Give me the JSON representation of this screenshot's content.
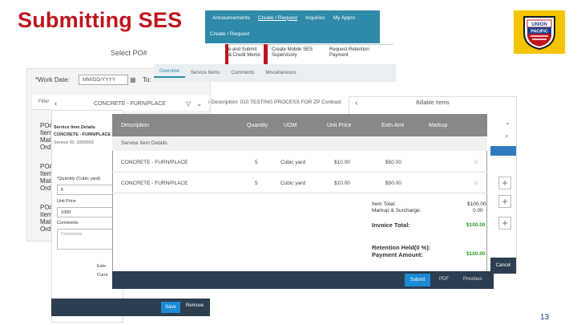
{
  "slide": {
    "title": "Submitting SES",
    "page_number": "13",
    "logo_text": [
      "UNION",
      "PACIFIC"
    ]
  },
  "topnav": {
    "items": [
      "Announcements",
      "Create / Request",
      "Inquiries",
      "My Appro"
    ],
    "sub_label": "Create / Request"
  },
  "dropdown": {
    "col1": [
      "e and Submit",
      "& Credit Memo"
    ],
    "col2": [
      "Create Mobile SES",
      "Supervisory"
    ],
    "col3": [
      "Request Retention",
      "Payment"
    ]
  },
  "select_po": "Select PO#",
  "work_date": {
    "label": "*Work Date:",
    "value": "MM/DD/YYYY",
    "to_label": "To:"
  },
  "filter": {
    "label": "Filter"
  },
  "po_items": [
    {
      "lines": [
        "PO#",
        "Item",
        "Mate",
        "Ord"
      ]
    },
    {
      "lines": [
        "PO#",
        "Item",
        "Mate",
        "Ord"
      ]
    },
    {
      "lines": [
        "PO#",
        "Item",
        "Mate",
        "Ord"
      ]
    }
  ],
  "overview_tabs": [
    "Overview",
    "Service Items",
    "Comments",
    "Miscellaneous"
  ],
  "description_line": "n Description: 010 TESTING PROCESS FOR ZP Contract",
  "service_panel": {
    "header": "CONCRETE - FURN/PLACE",
    "details_title": "Service Item Details",
    "item_name": "CONCRETE - FURN/PLACE",
    "service_id": "Service ID: 1000003",
    "quantity_label": "*Quantity (Cubic yard)",
    "quantity_value": "5",
    "unit_price_label": "Unit Price",
    "unit_price_value": "1000",
    "comments_label": "Comments",
    "comments_placeholder": "Comments",
    "extra_labels": [
      "Exte",
      "Curre"
    ],
    "save": "Save",
    "remove": "Remove"
  },
  "billable": {
    "header": "Billable Items"
  },
  "table": {
    "columns": [
      "Description",
      "Quantity",
      "UOM",
      "Unit Price",
      "Extn Amt",
      "Markup"
    ],
    "section": "Service Item Details",
    "rows": [
      {
        "description": "CONCRETE - FURN/PLACE",
        "quantity": "5",
        "uom": "Cubic yard",
        "unit_price": "$10.00",
        "extn_amt": "$50.00",
        "markup": "0"
      },
      {
        "description": "CONCRETE - FURN/PLACE",
        "quantity": "5",
        "uom": "Cubic yard",
        "unit_price": "$10.00",
        "extn_amt": "$50.00",
        "markup": "0"
      }
    ],
    "totals": {
      "item_total_label": "Item Total:",
      "item_total": "$100.00",
      "markup_label": "Markup & Surcharge:",
      "markup": "0.00",
      "invoice_label": "Invoice Total:",
      "invoice": "$100.00",
      "retention_label": "Retention Held(0 %):",
      "payment_label": "Payment Amount:",
      "payment": "$100.00"
    }
  },
  "actions": {
    "submit": "Submit",
    "pdf": "PDF",
    "previous": "Previous",
    "cancel": "Cancel"
  },
  "colors": {
    "title_red": "#c0141e",
    "nav_teal": "#2e8aa8",
    "action_blue": "#1a8ad4",
    "green_total": "#2a9a2a"
  }
}
